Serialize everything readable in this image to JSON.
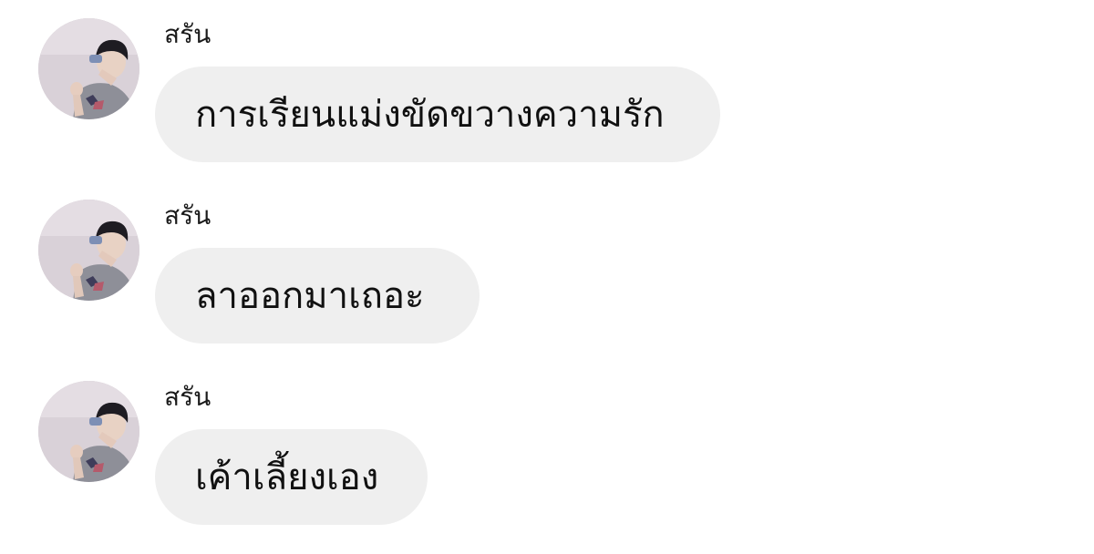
{
  "chat": {
    "messages": [
      {
        "sender": "สรัน",
        "text": "การเรียนแม่งขัดขวางความรัก"
      },
      {
        "sender": "สรัน",
        "text": "ลาออกมาเถอะ"
      },
      {
        "sender": "สรัน",
        "text": "เค้าเลี้ยงเอง"
      }
    ]
  },
  "icons": {
    "avatar": "user-avatar-photo"
  },
  "colors": {
    "bubble": "#efefef",
    "background": "#ffffff",
    "text": "#111111"
  }
}
